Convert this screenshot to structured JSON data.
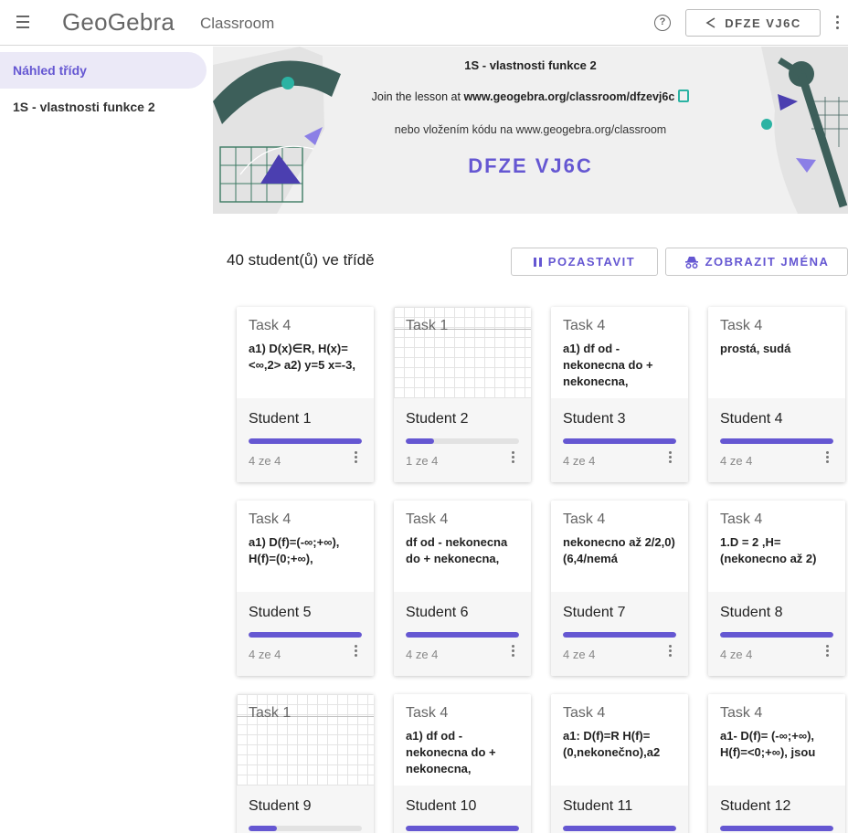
{
  "header": {
    "logo": "GeoGebra",
    "breadcrumb": "Classroom",
    "share_label": "DFZE VJ6C"
  },
  "sidebar": {
    "items": [
      {
        "label": "Náhled třídy"
      },
      {
        "label": "1S - vlastnosti funkce 2"
      }
    ]
  },
  "banner": {
    "title": "1S - vlastnosti funkce 2",
    "join_prefix": "Join the lesson at",
    "join_url": "www.geogebra.org/classroom/dfzevj6c",
    "alt": "nebo vložením kódu na www.geogebra.org/classroom",
    "code": "DFZE VJ6C"
  },
  "toolbar": {
    "count": "40 student(ů) ve třídě",
    "pause_label": "POZASTAVIT",
    "names_label": "ZOBRAZIT JMÉNA"
  },
  "cards": [
    {
      "task": "Task 4",
      "answer": "a1) D(x)∈R, H(x)=<∞,2> a2) y=5 x=-3,",
      "student": "Student 1",
      "progress": "4 ze 4",
      "fraction": 1.0,
      "thumbnail": false
    },
    {
      "task": "Task 1",
      "answer": "",
      "student": "Student 2",
      "progress": "1 ze 4",
      "fraction": 0.25,
      "thumbnail": true
    },
    {
      "task": "Task 4",
      "answer": "a1) df od - nekonecna do + nekonecna,",
      "student": "Student 3",
      "progress": "4 ze 4",
      "fraction": 1.0,
      "thumbnail": false
    },
    {
      "task": "Task 4",
      "answer": "prostá, sudá",
      "student": "Student 4",
      "progress": "4 ze 4",
      "fraction": 1.0,
      "thumbnail": false
    },
    {
      "task": "Task 4",
      "answer": "a1) D(f)=(-∞;+∞), H(f)=(0;+∞),",
      "student": "Student 5",
      "progress": "4 ze 4",
      "fraction": 1.0,
      "thumbnail": false
    },
    {
      "task": "Task 4",
      "answer": "df od - nekonecna do + nekonecna,",
      "student": "Student 6",
      "progress": "4 ze 4",
      "fraction": 1.0,
      "thumbnail": false
    },
    {
      "task": "Task 4",
      "answer": "nekonecno až 2/2,0) (6,4/nemá",
      "student": "Student 7",
      "progress": "4 ze 4",
      "fraction": 1.0,
      "thumbnail": false
    },
    {
      "task": "Task 4",
      "answer": "1.D = 2 ,H= (nekonecno až 2)",
      "student": "Student 8",
      "progress": "4 ze 4",
      "fraction": 1.0,
      "thumbnail": false
    },
    {
      "task": "Task 1",
      "answer": "",
      "student": "Student 9",
      "progress": "",
      "fraction": 0.25,
      "thumbnail": true
    },
    {
      "task": "Task 4",
      "answer": "a1) df od - nekonecna do + nekonecna,",
      "student": "Student 10",
      "progress": "",
      "fraction": 1.0,
      "thumbnail": false
    },
    {
      "task": "Task 4",
      "answer": "a1: D(f)=R H(f)= (0,nekonečno),a2",
      "student": "Student 11",
      "progress": "",
      "fraction": 1.0,
      "thumbnail": false
    },
    {
      "task": "Task 4",
      "answer": "a1- D(f)= (-∞;+∞), H(f)=<0;+∞), jsou",
      "student": "Student 12",
      "progress": "",
      "fraction": 1.0,
      "thumbnail": false
    }
  ],
  "colors": {
    "accent": "#6557d2",
    "teal": "#2bb3a3"
  }
}
